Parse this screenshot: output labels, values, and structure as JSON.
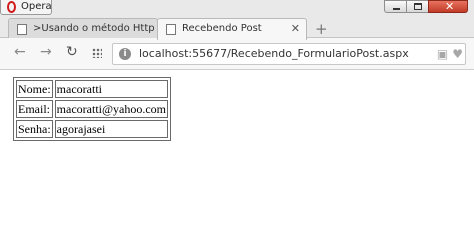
{
  "titlebar": {
    "menu_label": "Opera"
  },
  "tabs": [
    {
      "title": ">Usando o método Http Post",
      "active": false
    },
    {
      "title": "Recebendo Post",
      "active": true
    }
  ],
  "toolbar": {
    "url": "localhost:55677/Recebendo_FormularioPost.aspx"
  },
  "form_table": {
    "rows": [
      {
        "label": "Nome:",
        "value": "macoratti"
      },
      {
        "label": "Email:",
        "value": "macoratti@yahoo.com"
      },
      {
        "label": "Senha:",
        "value": "agorajasei"
      }
    ]
  }
}
